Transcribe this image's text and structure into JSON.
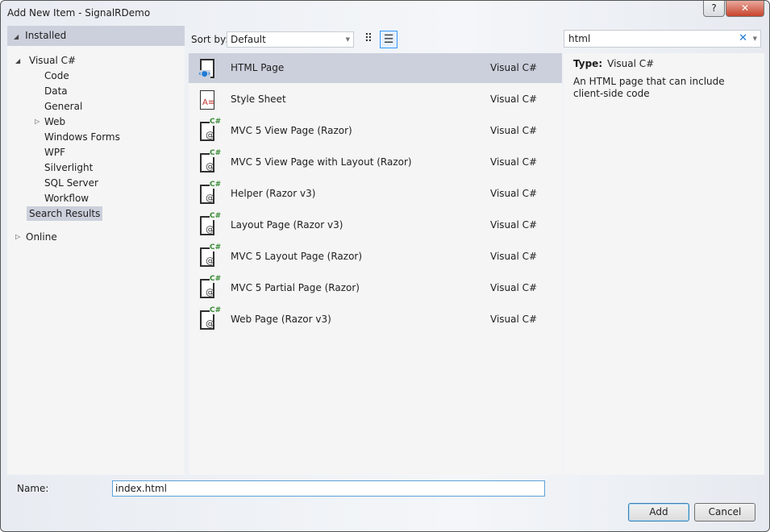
{
  "window": {
    "title": "Add New Item - SignalRDemo",
    "help": "?",
    "close": "✕"
  },
  "tree": {
    "installed": "Installed",
    "visual_csharp": "Visual C#",
    "children": [
      "Code",
      "Data",
      "General",
      "Web",
      "Windows Forms",
      "WPF",
      "Silverlight",
      "SQL Server",
      "Workflow",
      "Search Results"
    ],
    "online": "Online"
  },
  "sort": {
    "label": "Sort by:",
    "value": "Default"
  },
  "search": {
    "value": "html"
  },
  "items": [
    {
      "name": "HTML Page",
      "type": "Visual C#"
    },
    {
      "name": "Style Sheet",
      "type": "Visual C#"
    },
    {
      "name": "MVC 5 View Page (Razor)",
      "type": "Visual C#"
    },
    {
      "name": "MVC 5 View Page with Layout (Razor)",
      "type": "Visual C#"
    },
    {
      "name": "Helper (Razor v3)",
      "type": "Visual C#"
    },
    {
      "name": "Layout Page (Razor v3)",
      "type": "Visual C#"
    },
    {
      "name": "MVC 5 Layout Page (Razor)",
      "type": "Visual C#"
    },
    {
      "name": "MVC 5 Partial Page (Razor)",
      "type": "Visual C#"
    },
    {
      "name": "Web Page (Razor v3)",
      "type": "Visual C#"
    }
  ],
  "details": {
    "type_label": "Type:",
    "type_value": "Visual C#",
    "description": "An HTML page that can include client-side code"
  },
  "name": {
    "label": "Name:",
    "value": "index.html"
  },
  "buttons": {
    "add": "Add",
    "cancel": "Cancel"
  }
}
